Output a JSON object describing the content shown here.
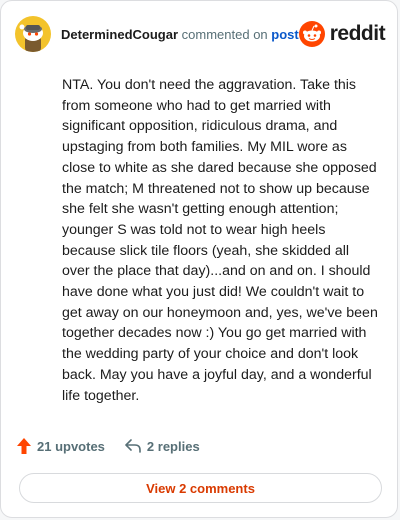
{
  "header": {
    "username": "DeterminedCougar",
    "commented_on": "commented on",
    "post_link": "post",
    "brand_word": "reddit",
    "brand_color": "#ff4500",
    "avatar_color": "#f3c32b",
    "avatar_icon": "snoo-avatar-icon"
  },
  "comment": {
    "body": "NTA. You don't need the aggravation. Take this from someone who had to get married with significant opposition, ridiculous drama, and upstaging from both families. My MIL wore as close to white as she dared because she opposed the match; M threatened not to show up because she felt she wasn't getting enough attention; younger S was told not to wear high heels because slick tile floors (yeah, she skidded all over the place that day)...and on and on. I should have done what you just did! We couldn't wait to get away on our honeymoon and, yes, we've been together decades now :) You go get married with the wedding party of your choice and don't look back. May you have a joyful day, and a wonderful life together."
  },
  "footer": {
    "upvotes": "21 upvotes",
    "upvote_icon": "upvote-arrow-icon",
    "replies": "2 replies",
    "reply_icon": "reply-arrow-icon",
    "view_comments": "View 2 comments",
    "upvote_color": "#ff4500",
    "view_color": "#d93a00"
  }
}
